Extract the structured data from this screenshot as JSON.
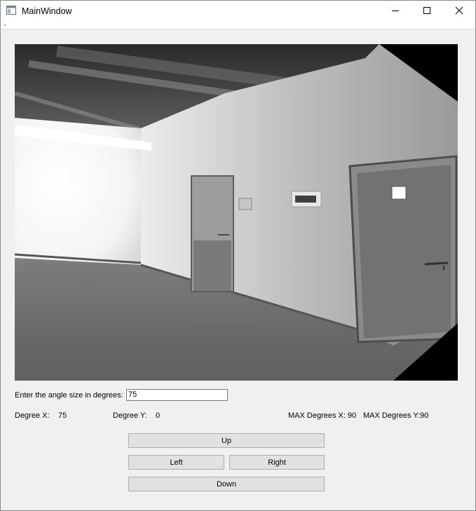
{
  "window": {
    "title": "MainWindow",
    "icon": "app-window-icon",
    "controls": [
      "minimize-icon",
      "maximize-icon",
      "close-icon"
    ]
  },
  "camera": {
    "description_icon": "camera-feed-image"
  },
  "angle": {
    "prompt": "Enter the angle size in degrees:",
    "value": "75"
  },
  "degrees": {
    "x_label": "Degree X:",
    "x_value": "75",
    "y_label": "Degree Y:",
    "y_value": "0",
    "max_x": "MAX Degrees X: 90",
    "max_y": "MAX Degrees Y:90"
  },
  "buttons": {
    "up": "Up",
    "left": "Left",
    "right": "Right",
    "down": "Down"
  }
}
